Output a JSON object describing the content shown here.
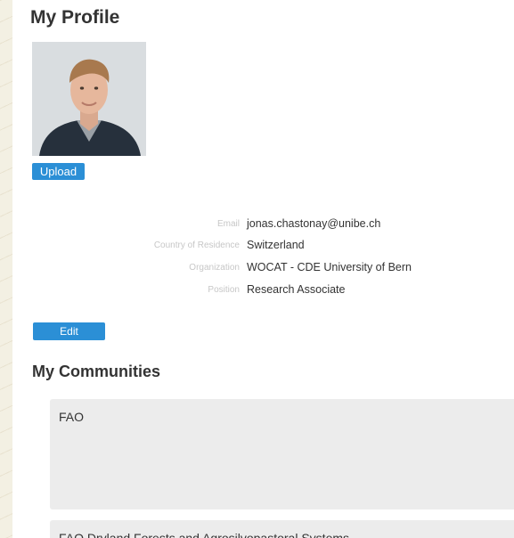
{
  "profile": {
    "title": "My Profile",
    "upload_label": "Upload",
    "edit_label": "Edit",
    "fields": [
      {
        "label": "Email",
        "value": "jonas.chastonay@unibe.ch"
      },
      {
        "label": "Country of Residence",
        "value": "Switzerland"
      },
      {
        "label": "Organization",
        "value": "WOCAT - CDE University of Bern"
      },
      {
        "label": "Position",
        "value": "Research Associate"
      }
    ]
  },
  "communities": {
    "title": "My Communities",
    "items": [
      {
        "name": "FAO"
      },
      {
        "name": "FAO Dryland Forests and Agrosilvopastoral Systems"
      }
    ]
  },
  "colors": {
    "accent": "#2b8fd6",
    "label_text": "#c7c7c7",
    "card_bg": "#ececec"
  }
}
